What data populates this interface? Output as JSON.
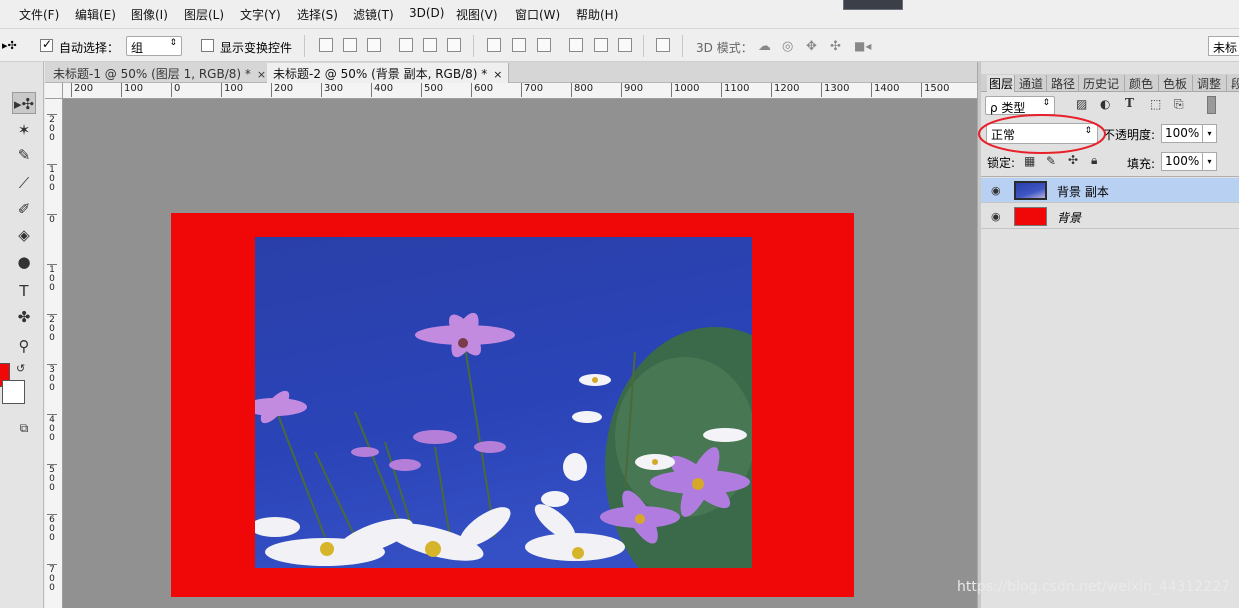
{
  "menu": [
    "文件(F)",
    "编辑(E)",
    "图像(I)",
    "图层(L)",
    "文字(Y)",
    "选择(S)",
    "滤镜(T)",
    "3D(D)",
    "视图(V)",
    "窗口(W)",
    "帮助(H)"
  ],
  "options": {
    "auto_select_label": "自动选择：",
    "auto_select_value": "组",
    "show_transform_label": "显示变换控件",
    "mode_label": "3D 模式：",
    "right_field": "未标"
  },
  "tabs": [
    {
      "label": "未标题-1 @ 50% (图层 1, RGB/8) *",
      "close": "×"
    },
    {
      "label": "未标题-2 @ 50% (背景 副本, RGB/8) *",
      "close": "×"
    }
  ],
  "ruler_h": [
    "200",
    "100",
    "0",
    "100",
    "200",
    "300",
    "400",
    "500",
    "600",
    "700",
    "800",
    "900",
    "1000",
    "1100",
    "1200",
    "1300",
    "1400",
    "1500"
  ],
  "ruler_v": [
    "2 0 0",
    "1 0 0",
    "0",
    "1 0 0",
    "2 0 0",
    "3 0 0",
    "4 0 0",
    "5 0 0",
    "6 0 0",
    "7 0 0"
  ],
  "panel": {
    "tabs": [
      "图层",
      "通道",
      "路径",
      "历史记",
      "颜色",
      "色板",
      "调整",
      "段"
    ],
    "filter_label": "ρ 类型",
    "blend_mode": "正常",
    "opacity_label": "不透明度:",
    "opacity_value": "100%",
    "lock_label": "锁定:",
    "fill_label": "填充:",
    "fill_value": "100%",
    "layers": [
      {
        "name": "背景 副本",
        "selected": true
      },
      {
        "name": "背景",
        "selected": false
      }
    ]
  },
  "colors": {
    "foreground": "#f00808",
    "background": "#ffffff",
    "selected_layer": "#b8d0f2",
    "annotation": "#e8202a"
  },
  "watermark": "https://blog.csdn.net/weixin_44312227"
}
